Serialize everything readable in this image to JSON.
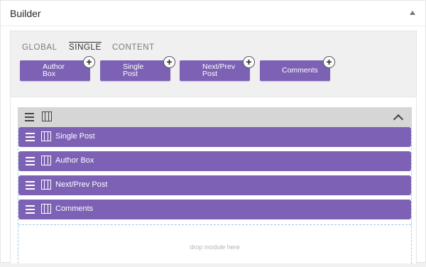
{
  "panel": {
    "title": "Builder"
  },
  "tabs": [
    {
      "label": "GLOBAL"
    },
    {
      "label": "SINGLE"
    },
    {
      "label": "CONTENT"
    }
  ],
  "module_buttons": [
    {
      "line1": "Author",
      "line2": "Box"
    },
    {
      "line1": "Single",
      "line2": "Post"
    },
    {
      "line1": "Next/Prev",
      "line2": "Post"
    },
    {
      "line1": "Comments",
      "line2": ""
    }
  ],
  "plus_label": "+",
  "rows": [
    {
      "label": "Single Post"
    },
    {
      "label": "Author Box"
    },
    {
      "label": "Next/Prev Post"
    },
    {
      "label": "Comments"
    }
  ],
  "drop_zone": {
    "text": "drop module here"
  },
  "colors": {
    "module_purple": "#7c61b5",
    "drop_border": "#9fc9e8",
    "toolbar_gray": "#d6d6d6"
  }
}
